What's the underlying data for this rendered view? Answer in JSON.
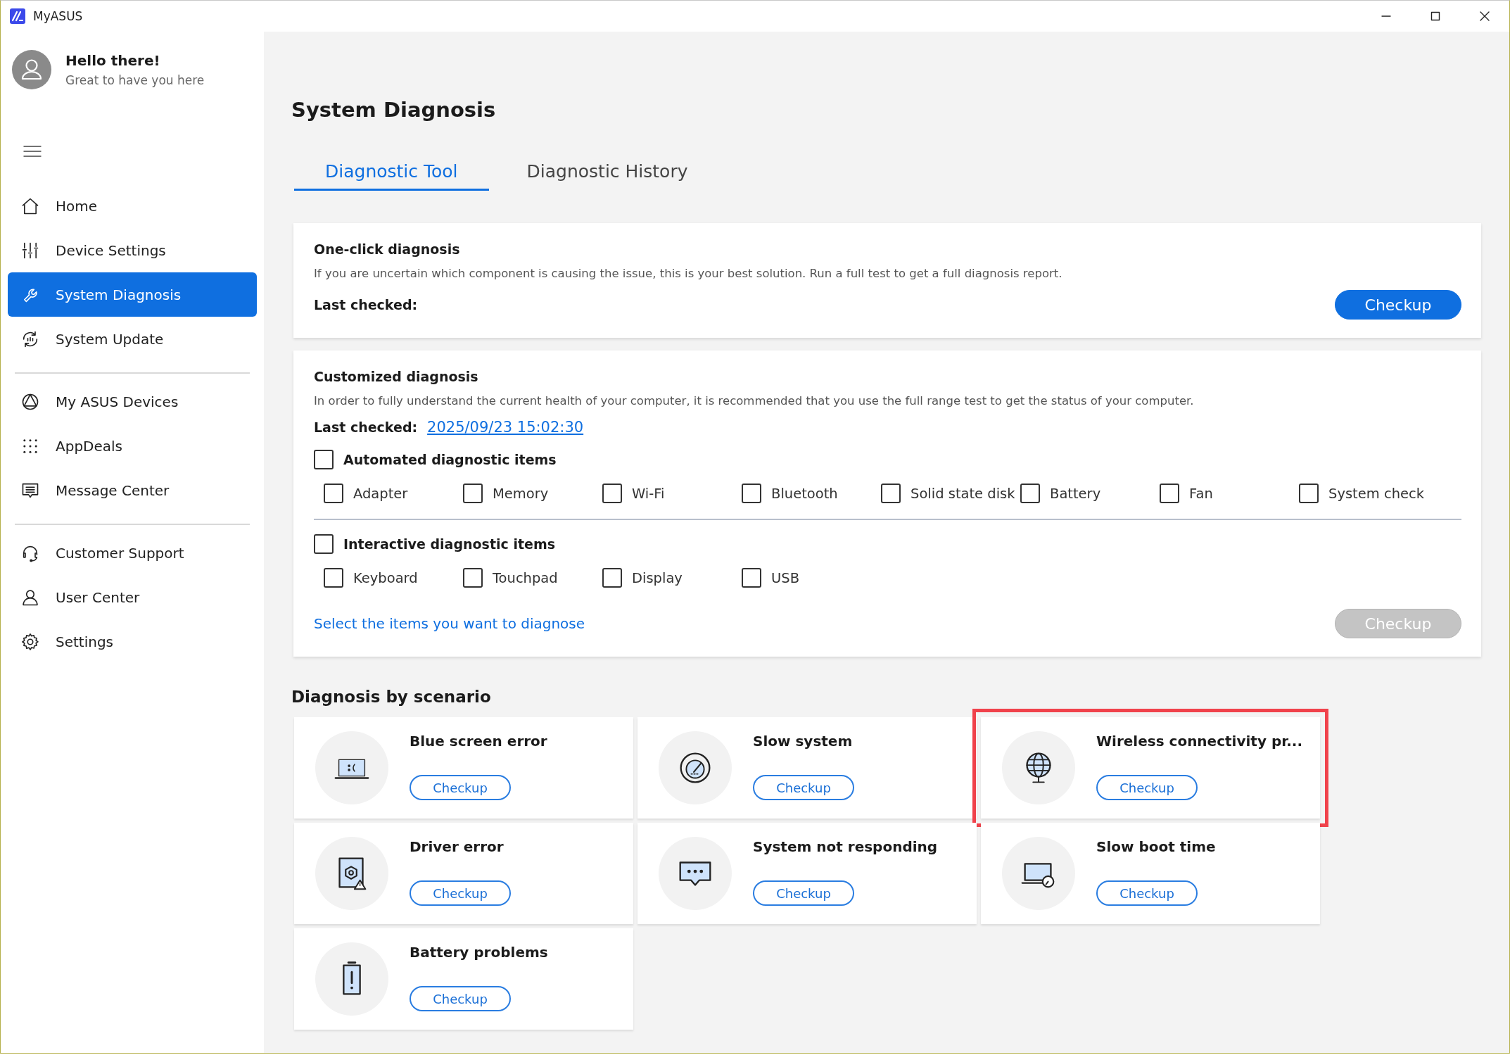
{
  "window": {
    "title": "MyASUS"
  },
  "user": {
    "greeting": "Hello there!",
    "subtitle": "Great to have you here"
  },
  "sidebar": {
    "sections": [
      {
        "items": [
          {
            "label": "Home",
            "selected": false
          },
          {
            "label": "Device Settings",
            "selected": false
          },
          {
            "label": "System Diagnosis",
            "selected": true
          },
          {
            "label": "System Update",
            "selected": false
          }
        ]
      },
      {
        "items": [
          {
            "label": "My ASUS Devices",
            "selected": false
          },
          {
            "label": "AppDeals",
            "selected": false
          },
          {
            "label": "Message Center",
            "selected": false
          }
        ]
      },
      {
        "items": [
          {
            "label": "Customer Support",
            "selected": false
          },
          {
            "label": "User Center",
            "selected": false
          },
          {
            "label": "Settings",
            "selected": false
          }
        ]
      }
    ]
  },
  "page_title": "System Diagnosis",
  "tabs": [
    {
      "label": "Diagnostic Tool",
      "selected": true
    },
    {
      "label": "Diagnostic History",
      "selected": false
    }
  ],
  "one_click": {
    "title": "One-click diagnosis",
    "description": "If you are uncertain which component is causing the issue, this is your best solution. Run a full test to get a full diagnosis report.",
    "last_checked_label": "Last checked:",
    "button": {
      "label": "Checkup",
      "disabled": false
    }
  },
  "customized": {
    "title": "Customized diagnosis",
    "description": "In order to fully understand the current health of your computer, it is recommended that you use the full range test to get the status of your computer.",
    "last_checked_label": "Last checked:",
    "last_checked_value": "2025/09/23 15:02:30",
    "groups": [
      {
        "label": "Automated diagnostic items",
        "checked": false,
        "items": [
          {
            "label": "Adapter",
            "checked": false
          },
          {
            "label": "Memory",
            "checked": false
          },
          {
            "label": "Wi-Fi",
            "checked": false
          },
          {
            "label": "Bluetooth",
            "checked": false
          },
          {
            "label": "Solid state disk",
            "checked": false
          },
          {
            "label": "Battery",
            "checked": false
          },
          {
            "label": "Fan",
            "checked": false
          },
          {
            "label": "System check",
            "checked": false
          }
        ]
      },
      {
        "label": "Interactive diagnostic items",
        "checked": false,
        "items": [
          {
            "label": "Keyboard",
            "checked": false
          },
          {
            "label": "Touchpad",
            "checked": false
          },
          {
            "label": "Display",
            "checked": false
          },
          {
            "label": "USB",
            "checked": false
          }
        ]
      }
    ],
    "hint": "Select the items you want to diagnose",
    "button": {
      "label": "Checkup",
      "disabled": true
    }
  },
  "scenarios": {
    "title": "Diagnosis by scenario",
    "items": [
      {
        "label": "Blue screen error",
        "button": "Checkup",
        "highlighted": false
      },
      {
        "label": "Slow system",
        "button": "Checkup",
        "highlighted": false
      },
      {
        "label": "Wireless connectivity pr...",
        "button": "Checkup",
        "highlighted": true
      },
      {
        "label": "Driver error",
        "button": "Checkup",
        "highlighted": false
      },
      {
        "label": "System not responding",
        "button": "Checkup",
        "highlighted": false
      },
      {
        "label": "Slow boot time",
        "button": "Checkup",
        "highlighted": false
      },
      {
        "label": "Battery problems",
        "button": "Checkup",
        "highlighted": false
      }
    ]
  }
}
